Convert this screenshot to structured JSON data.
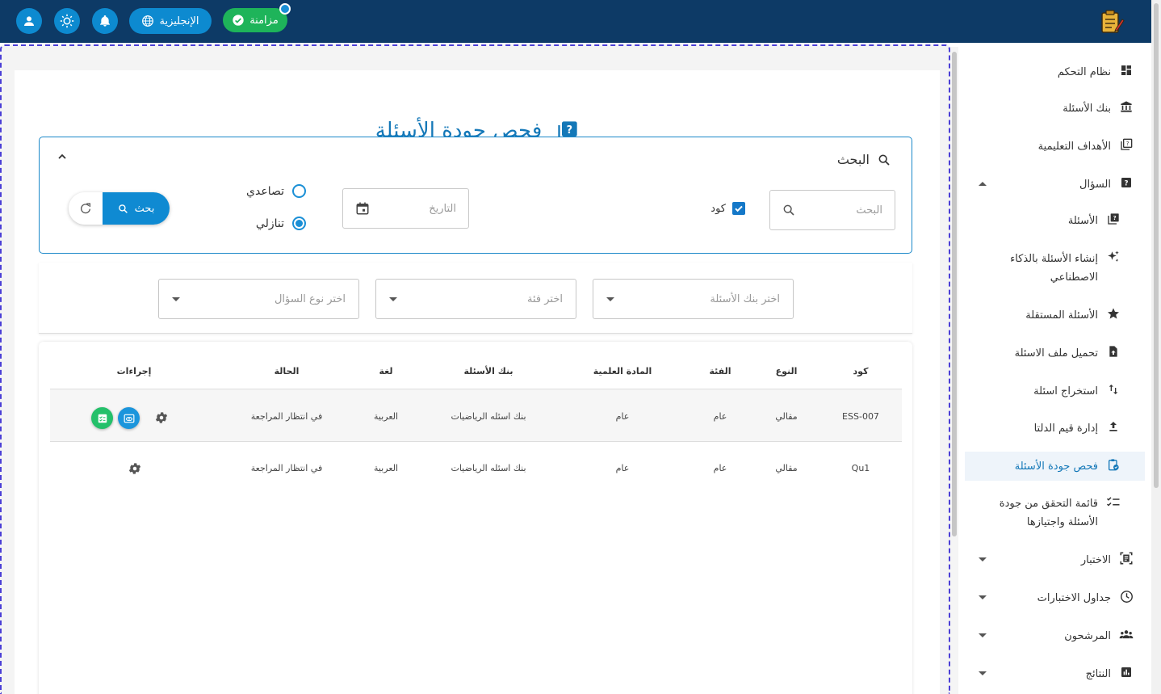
{
  "topbar": {
    "sync_label": "مزامنة",
    "lang_label": "الإنجليزية",
    "icons": [
      "user-icon",
      "brightness-icon",
      "bell-icon",
      "globe-icon",
      "check-circle-icon",
      "app-logo"
    ]
  },
  "page": {
    "title": "فحص جودة الأسئلة"
  },
  "search": {
    "header": "البحث",
    "search_placeholder": "البحث",
    "code_label": "كود",
    "date_placeholder": "التاريخ",
    "ascending_label": "تصاعدي",
    "descending_label": "تنازلي",
    "sort_selected": "descending",
    "search_button": "بحث"
  },
  "filters": {
    "bank_placeholder": "اختر بنك الأسئلة",
    "category_placeholder": "اختر فئة",
    "qtype_placeholder": "اختر نوع السؤال"
  },
  "table": {
    "headers": {
      "code": "كود",
      "type": "النوع",
      "category": "الفئة",
      "subject": "المادة العلمية",
      "bank": "بنك الأسئلة",
      "lang": "لغة",
      "status": "الحالة",
      "actions": "إجراءات"
    },
    "rows": [
      {
        "code": "ESS-007",
        "type": "مقالي",
        "category": "عام",
        "subject": "عام",
        "bank": "بنك اسئله الرياضيات",
        "lang": "العربية",
        "status": "في انتظار المراجعة"
      },
      {
        "code": "Qu1",
        "type": "مقالي",
        "category": "عام",
        "subject": "عام",
        "bank": "بنك اسئله الرياضيات",
        "lang": "العربية",
        "status": "في انتظار المراجعة"
      }
    ]
  },
  "sidebar": {
    "items": [
      {
        "label": "نظام التحكم",
        "icon": "dashboard-icon"
      },
      {
        "label": "بنك الأسئلة",
        "icon": "bank-icon"
      },
      {
        "label": "الأهداف التعليمية",
        "icon": "book-icon"
      },
      {
        "label": "السؤال",
        "icon": "question-icon"
      },
      {
        "label": "الأسئلة",
        "icon": "questions-icon"
      },
      {
        "label": "إنشاء الأسئلة بالذكاء الاصطناعي",
        "icon": "sparkle-icon"
      },
      {
        "label": "الأسئلة المستقلة",
        "icon": "star-icon"
      },
      {
        "label": "تحميل ملف الاسئلة",
        "icon": "upload-file-icon"
      },
      {
        "label": "استخراج اسئلة",
        "icon": "swap-vertical-icon"
      },
      {
        "label": "إدارة قيم الدلتا",
        "icon": "upload-icon"
      },
      {
        "label": "فحص جودة الأسئلة",
        "icon": "clipboard-check-icon"
      },
      {
        "label": "قائمة التحقق من جودة الأسئلة واجتيازها",
        "icon": "checklist-icon"
      },
      {
        "label": "الاختبار",
        "icon": "exam-icon"
      },
      {
        "label": "جداول الاختبارات",
        "icon": "clock-icon"
      },
      {
        "label": "المرشحون",
        "icon": "people-icon"
      },
      {
        "label": "النتائج",
        "icon": "chart-icon"
      }
    ]
  },
  "colors": {
    "topbar": "#0d3a66",
    "accent": "#1478b8",
    "button": "#0f8ad2",
    "sync": "#1eb45a"
  }
}
